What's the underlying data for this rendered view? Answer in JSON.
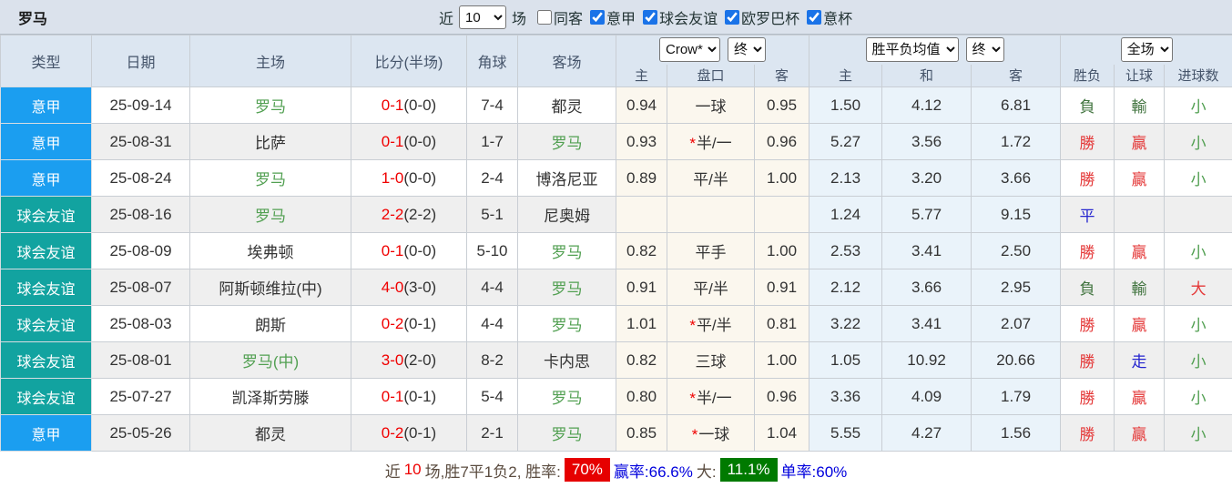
{
  "colors": {
    "type-blue": "#1b9ef0",
    "type-teal": "#12a3a0",
    "team-green": "#52a052",
    "score-red": "#f00000",
    "win-red": "#e43838",
    "lose-green": "#41743f",
    "push-blue": "#2525cf",
    "under-green": "#4f9e4f",
    "badge-red": "#e60000",
    "badge-green": "#007a00",
    "summary-blue": "#0000dd",
    "summary-dark": "#5b4c40",
    "summary-red": "#ee0000"
  },
  "topbar": {
    "title": "罗马",
    "recent_label": "近",
    "recent_count": "10",
    "games_label": "场",
    "same_opponent": {
      "label": "同客",
      "checked": false
    },
    "leagues": [
      {
        "label": "意甲",
        "checked": true
      },
      {
        "label": "球会友谊",
        "checked": true
      },
      {
        "label": "欧罗巴杯",
        "checked": true
      },
      {
        "label": "意杯",
        "checked": true
      }
    ]
  },
  "header": {
    "columns_left": [
      "类型",
      "日期",
      "主场",
      "比分(半场)",
      "角球",
      "客场"
    ],
    "odds_group": {
      "selects": [
        "Crow*",
        "终"
      ],
      "sub": [
        "主",
        "盘口",
        "客"
      ]
    },
    "avg_group": {
      "selects": [
        "胜平负均值",
        "终"
      ],
      "sub": [
        "主",
        "和",
        "客"
      ]
    },
    "result_group": {
      "selects": [
        "全场"
      ],
      "sub": [
        "胜负",
        "让球",
        "进球数"
      ]
    }
  },
  "rows": [
    {
      "type": {
        "text": "意甲",
        "color": "blue"
      },
      "date": "25-09-14",
      "home": {
        "text": "罗马",
        "green": true
      },
      "score_ft": "0-1",
      "score_ht": "(0-0)",
      "corner": "7-4",
      "away": {
        "text": "都灵",
        "green": false
      },
      "odds_home": "0.94",
      "handicap": {
        "star": false,
        "text": "一球"
      },
      "odds_away": "0.95",
      "avg_home": "1.50",
      "avg_draw": "4.12",
      "avg_away": "6.81",
      "result": {
        "text": "負",
        "color": "dgreen"
      },
      "spread": {
        "text": "輸",
        "color": "dgreen"
      },
      "goals": {
        "text": "小",
        "color": "green"
      }
    },
    {
      "type": {
        "text": "意甲",
        "color": "blue"
      },
      "date": "25-08-31",
      "home": {
        "text": "比萨",
        "green": false
      },
      "score_ft": "0-1",
      "score_ht": "(0-0)",
      "corner": "1-7",
      "away": {
        "text": "罗马",
        "green": true
      },
      "odds_home": "0.93",
      "handicap": {
        "star": true,
        "text": "半/一"
      },
      "odds_away": "0.96",
      "avg_home": "5.27",
      "avg_draw": "3.56",
      "avg_away": "1.72",
      "result": {
        "text": "勝",
        "color": "red"
      },
      "spread": {
        "text": "贏",
        "color": "red"
      },
      "goals": {
        "text": "小",
        "color": "green"
      }
    },
    {
      "type": {
        "text": "意甲",
        "color": "blue"
      },
      "date": "25-08-24",
      "home": {
        "text": "罗马",
        "green": true
      },
      "score_ft": "1-0",
      "score_ht": "(0-0)",
      "corner": "2-4",
      "away": {
        "text": "博洛尼亚",
        "green": false
      },
      "odds_home": "0.89",
      "handicap": {
        "star": false,
        "text": "平/半"
      },
      "odds_away": "1.00",
      "avg_home": "2.13",
      "avg_draw": "3.20",
      "avg_away": "3.66",
      "result": {
        "text": "勝",
        "color": "red"
      },
      "spread": {
        "text": "贏",
        "color": "red"
      },
      "goals": {
        "text": "小",
        "color": "green"
      }
    },
    {
      "type": {
        "text": "球会友谊",
        "color": "teal"
      },
      "date": "25-08-16",
      "home": {
        "text": "罗马",
        "green": true
      },
      "score_ft": "2-2",
      "score_ht": "(2-2)",
      "corner": "5-1",
      "away": {
        "text": "尼奥姆",
        "green": false
      },
      "odds_home": "",
      "handicap": {
        "star": false,
        "text": ""
      },
      "odds_away": "",
      "avg_home": "1.24",
      "avg_draw": "5.77",
      "avg_away": "9.15",
      "result": {
        "text": "平",
        "color": "blue"
      },
      "spread": {
        "text": "",
        "color": "blue"
      },
      "goals": {
        "text": "",
        "color": "green"
      }
    },
    {
      "type": {
        "text": "球会友谊",
        "color": "teal"
      },
      "date": "25-08-09",
      "home": {
        "text": "埃弗顿",
        "green": false
      },
      "score_ft": "0-1",
      "score_ht": "(0-0)",
      "corner": "5-10",
      "away": {
        "text": "罗马",
        "green": true
      },
      "odds_home": "0.82",
      "handicap": {
        "star": false,
        "text": "平手"
      },
      "odds_away": "1.00",
      "avg_home": "2.53",
      "avg_draw": "3.41",
      "avg_away": "2.50",
      "result": {
        "text": "勝",
        "color": "red"
      },
      "spread": {
        "text": "贏",
        "color": "red"
      },
      "goals": {
        "text": "小",
        "color": "green"
      }
    },
    {
      "type": {
        "text": "球会友谊",
        "color": "teal"
      },
      "date": "25-08-07",
      "home": {
        "text": "阿斯顿维拉(中)",
        "green": false
      },
      "score_ft": "4-0",
      "score_ht": "(3-0)",
      "corner": "4-4",
      "away": {
        "text": "罗马",
        "green": true
      },
      "odds_home": "0.91",
      "handicap": {
        "star": false,
        "text": "平/半"
      },
      "odds_away": "0.91",
      "avg_home": "2.12",
      "avg_draw": "3.66",
      "avg_away": "2.95",
      "result": {
        "text": "負",
        "color": "dgreen"
      },
      "spread": {
        "text": "輸",
        "color": "dgreen"
      },
      "goals": {
        "text": "大",
        "color": "red"
      }
    },
    {
      "type": {
        "text": "球会友谊",
        "color": "teal"
      },
      "date": "25-08-03",
      "home": {
        "text": "朗斯",
        "green": false
      },
      "score_ft": "0-2",
      "score_ht": "(0-1)",
      "corner": "4-4",
      "away": {
        "text": "罗马",
        "green": true
      },
      "odds_home": "1.01",
      "handicap": {
        "star": true,
        "text": "平/半"
      },
      "odds_away": "0.81",
      "avg_home": "3.22",
      "avg_draw": "3.41",
      "avg_away": "2.07",
      "result": {
        "text": "勝",
        "color": "red"
      },
      "spread": {
        "text": "贏",
        "color": "red"
      },
      "goals": {
        "text": "小",
        "color": "green"
      }
    },
    {
      "type": {
        "text": "球会友谊",
        "color": "teal"
      },
      "date": "25-08-01",
      "home": {
        "text": "罗马(中)",
        "green": true
      },
      "score_ft": "3-0",
      "score_ht": "(2-0)",
      "corner": "8-2",
      "away": {
        "text": "卡内思",
        "green": false
      },
      "odds_home": "0.82",
      "handicap": {
        "star": false,
        "text": "三球"
      },
      "odds_away": "1.00",
      "avg_home": "1.05",
      "avg_draw": "10.92",
      "avg_away": "20.66",
      "result": {
        "text": "勝",
        "color": "red"
      },
      "spread": {
        "text": "走",
        "color": "blue"
      },
      "goals": {
        "text": "小",
        "color": "green"
      }
    },
    {
      "type": {
        "text": "球会友谊",
        "color": "teal"
      },
      "date": "25-07-27",
      "home": {
        "text": "凯泽斯劳滕",
        "green": false
      },
      "score_ft": "0-1",
      "score_ht": "(0-1)",
      "corner": "5-4",
      "away": {
        "text": "罗马",
        "green": true
      },
      "odds_home": "0.80",
      "handicap": {
        "star": true,
        "text": "半/一"
      },
      "odds_away": "0.96",
      "avg_home": "3.36",
      "avg_draw": "4.09",
      "avg_away": "1.79",
      "result": {
        "text": "勝",
        "color": "red"
      },
      "spread": {
        "text": "贏",
        "color": "red"
      },
      "goals": {
        "text": "小",
        "color": "green"
      }
    },
    {
      "type": {
        "text": "意甲",
        "color": "blue"
      },
      "date": "25-05-26",
      "home": {
        "text": "都灵",
        "green": false
      },
      "score_ft": "0-2",
      "score_ht": "(0-1)",
      "corner": "2-1",
      "away": {
        "text": "罗马",
        "green": true
      },
      "odds_home": "0.85",
      "handicap": {
        "star": true,
        "text": "一球"
      },
      "odds_away": "1.04",
      "avg_home": "5.55",
      "avg_draw": "4.27",
      "avg_away": "1.56",
      "result": {
        "text": "勝",
        "color": "red"
      },
      "spread": {
        "text": "贏",
        "color": "red"
      },
      "goals": {
        "text": "小",
        "color": "green"
      }
    }
  ],
  "summary": {
    "segments": [
      {
        "text": "近",
        "style": "dark"
      },
      {
        "text": "10",
        "style": "red"
      },
      {
        "text": "场,胜7平1负2, 胜率:",
        "style": "dark"
      },
      {
        "text": "70%",
        "style": "badge-red"
      },
      {
        "text": "赢率:66.6%",
        "style": "blue"
      },
      {
        "text": "大:",
        "style": "dark"
      },
      {
        "text": "11.1%",
        "style": "badge-green"
      },
      {
        "text": "单率:60%",
        "style": "blue"
      }
    ]
  }
}
